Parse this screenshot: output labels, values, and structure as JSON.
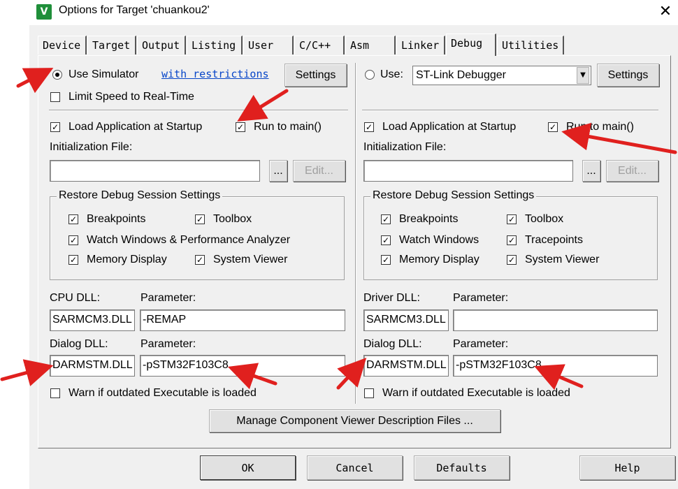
{
  "window": {
    "title": "Options for Target 'chuankou2'",
    "close_glyph": "✕",
    "icon_glyph": "V"
  },
  "tabs": [
    "Device",
    "Target",
    "Output",
    "Listing",
    "User",
    "C/C++",
    "Asm",
    "Linker",
    "Debug",
    "Utilities"
  ],
  "active_tab": "Debug",
  "left": {
    "use_simulator_label": "Use Simulator",
    "with_restrictions": "with restrictions",
    "settings_label": "Settings",
    "limit_speed_label": "Limit Speed to Real-Time",
    "load_app_label": "Load Application at Startup",
    "run_to_main_label": "Run to main()",
    "init_file_label": "Initialization File:",
    "init_file_value": "",
    "browse_label": "...",
    "edit_label": "Edit...",
    "restore_group_title": "Restore Debug Session Settings",
    "restore_items": [
      "Breakpoints",
      "Toolbox",
      "Watch Windows & Performance Analyzer",
      "Memory Display",
      "System Viewer"
    ],
    "cpu_dll_label": "CPU DLL:",
    "param_label": "Parameter:",
    "cpu_dll_value": "SARMCM3.DLL",
    "cpu_param_value": "-REMAP",
    "dialog_dll_label": "Dialog DLL:",
    "dialog_dll_value": "DARMSTM.DLL",
    "dialog_param_value": "-pSTM32F103C8",
    "warn_label": "Warn if outdated Executable is loaded"
  },
  "right": {
    "use_label": "Use:",
    "debugger_value": "ST-Link Debugger",
    "settings_label": "Settings",
    "load_app_label": "Load Application at Startup",
    "run_to_main_label": "Run to main()",
    "init_file_label": "Initialization File:",
    "init_file_value": "",
    "browse_label": "...",
    "edit_label": "Edit...",
    "restore_group_title": "Restore Debug Session Settings",
    "restore_items": [
      "Breakpoints",
      "Toolbox",
      "Watch Windows",
      "Tracepoints",
      "Memory Display",
      "System Viewer"
    ],
    "driver_dll_label": "Driver DLL:",
    "param_label": "Parameter:",
    "driver_dll_value": "SARMCM3.DLL",
    "driver_param_value": "",
    "dialog_dll_label": "Dialog DLL:",
    "dialog_dll_value": "DARMSTM.DLL",
    "dialog_param_value": "-pSTM32F103C8",
    "warn_label": "Warn if outdated Executable is loaded"
  },
  "manage_label": "Manage Component Viewer Description Files ...",
  "footer": {
    "ok": "OK",
    "cancel": "Cancel",
    "defaults": "Defaults",
    "help": "Help"
  },
  "colors": {
    "dialog_bg": "#f0f0f0",
    "annotation_arrow": "#e0201e",
    "link": "#0645c8"
  }
}
